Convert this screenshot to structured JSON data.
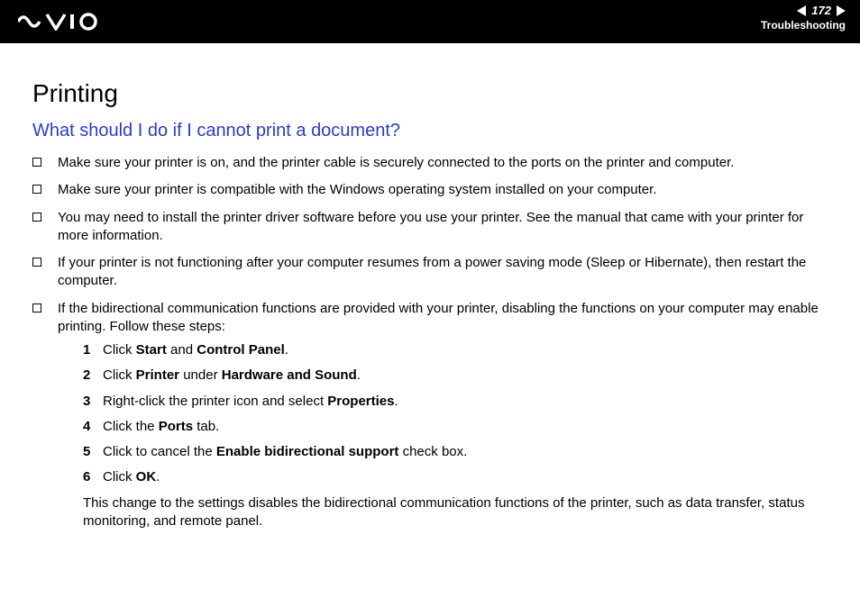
{
  "header": {
    "page_number": "172",
    "section": "Troubleshooting"
  },
  "content": {
    "title": "Printing",
    "subtitle": "What should I do if I cannot print a document?",
    "bullets": [
      "Make sure your printer is on, and the printer cable is securely connected to the ports on the printer and computer.",
      "Make sure your printer is compatible with the Windows operating system installed on your computer.",
      "You may need to install the printer driver software before you use your printer. See the manual that came with your printer for more information.",
      "If your printer is not functioning after your computer resumes from a power saving mode (Sleep or Hibernate), then restart the computer.",
      "If the bidirectional communication functions are provided with your printer, disabling the functions on your computer may enable printing. Follow these steps:"
    ],
    "steps": [
      {
        "n": "1",
        "pre": "Click ",
        "b1": "Start",
        "mid": " and ",
        "b2": "Control Panel",
        "post": "."
      },
      {
        "n": "2",
        "pre": "Click ",
        "b1": "Printer",
        "mid": " under ",
        "b2": "Hardware and Sound",
        "post": "."
      },
      {
        "n": "3",
        "pre": "Right-click the printer icon and select ",
        "b1": "Properties",
        "mid": "",
        "b2": "",
        "post": "."
      },
      {
        "n": "4",
        "pre": "Click the ",
        "b1": "Ports",
        "mid": "",
        "b2": "",
        "post": " tab."
      },
      {
        "n": "5",
        "pre": "Click to cancel the ",
        "b1": "Enable bidirectional support",
        "mid": "",
        "b2": "",
        "post": " check box."
      },
      {
        "n": "6",
        "pre": "Click ",
        "b1": "OK",
        "mid": "",
        "b2": "",
        "post": "."
      }
    ],
    "note": "This change to the settings disables the bidirectional communication functions of the printer, such as data transfer, status monitoring, and remote panel."
  }
}
